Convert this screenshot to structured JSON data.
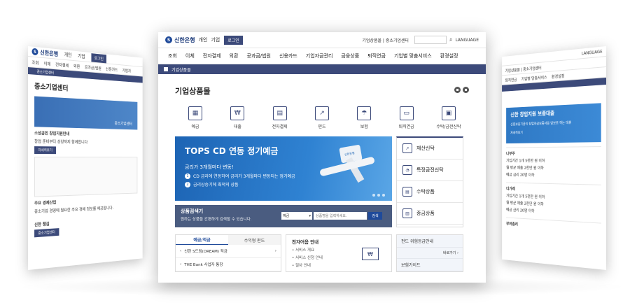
{
  "left_panel": {
    "logo": "신한은행",
    "top_links": [
      "개인",
      "기업"
    ],
    "login": "로그인",
    "nav": [
      "조회",
      "이체",
      "전자결제",
      "외환",
      "공과금/법원",
      "신용카드",
      "기업자"
    ],
    "bar": "중소기업센터",
    "title": "중소기업센터",
    "banner_caption": "중소기업센터",
    "notice_title": "소상공인 창업지원안내",
    "notice_text": "창업 준비부터 성장까지 함께합니다",
    "button": "자세히보기",
    "section": "주요 경제산업",
    "section_text": "중소기업 경영에 필요한 주요 경제 정보를 제공합니다.",
    "bottom": "신한 챙김",
    "bottom_btn": "중소기업센터"
  },
  "right_panel": {
    "lang": "LANGUAGE",
    "top_links": "기업상품몰 | 중소기업센터",
    "nav": [
      "퇴직연금",
      "기업별 맞춤서비스",
      "환경설정"
    ],
    "banner_title": "신한 창업지원 보증대출",
    "banner_text": "신용보증기금의 창업자금보증서를 담보로 하는 대출",
    "banner_link": "자세히보기",
    "sections": [
      "나부주",
      "디가레",
      "부여총리"
    ],
    "rows": [
      "가입기간 1개 5천만 원 이하",
      "월 평균 매출 2천만 원 이하",
      "예금 금리 20명 이하"
    ]
  },
  "main": {
    "logo": "신한은행",
    "top_links": [
      "개인",
      "기업"
    ],
    "login": "로그인",
    "right_links": "기업상품몰 | 중소기업센터",
    "lang": "LANGUAGE",
    "nav": [
      "조회",
      "이체",
      "전자결제",
      "외환",
      "공과금/법원",
      "신용카드",
      "기업자금관리",
      "금융상품",
      "퇴직연금",
      "기업별 맞춤서비스",
      "환경설정"
    ],
    "breadcrumb": "기업상품몰",
    "title": "기업상품몰",
    "categories": [
      {
        "label": "예금",
        "icon": "deposit-icon",
        "glyph": "▦"
      },
      {
        "label": "대출",
        "icon": "loan-icon",
        "glyph": "₩"
      },
      {
        "label": "전자결제",
        "icon": "epayment-icon",
        "glyph": "▤"
      },
      {
        "label": "펀드",
        "icon": "fund-icon",
        "glyph": "↗"
      },
      {
        "label": "보험",
        "icon": "insurance-icon",
        "glyph": "☂"
      },
      {
        "label": "퇴직연금",
        "icon": "pension-icon",
        "glyph": "▭"
      },
      {
        "label": "수탁/금전신탁",
        "icon": "trust-icon",
        "glyph": "▣"
      }
    ],
    "hero": {
      "title": "TOPS CD 연동 정기예금",
      "subtitle": "금리가 3개월마다 변동!",
      "items": [
        {
          "num": "1",
          "text": "CD 금리에 연동하여 금리가 3개월마다 변동되는 정기예금"
        },
        {
          "num": "2",
          "text": "금리상승기에 최적의 상품"
        }
      ],
      "card_label": "신한은행"
    },
    "side_menu": [
      {
        "label": "재산신탁",
        "icon": "chart-icon",
        "glyph": "↗"
      },
      {
        "label": "특정금전신탁",
        "icon": "pie-icon",
        "glyph": "◔"
      },
      {
        "label": "수탁상품",
        "icon": "document-icon",
        "glyph": "▤"
      },
      {
        "label": "중금상품",
        "icon": "note-icon",
        "glyph": "▥"
      }
    ],
    "search": {
      "title": "상품검색기",
      "desc": "원하는 상품을 간편하게 검색할 수 있습니다.",
      "select": "예금",
      "placeholder": "상품명을 입력하세요.",
      "button": "검색"
    },
    "tabs": [
      "예금/적금",
      "수익형 펀드"
    ],
    "products": [
      "신한 S드림(DREAM) 적금",
      "THE Bank 사업자 통장"
    ],
    "epay": {
      "title": "전자어음 안내",
      "items": [
        "서비스 개요",
        "서비스 신청 안내",
        "절차 안내"
      ]
    },
    "guide": {
      "title": "펀드 위험등급안내",
      "more": "바로가기",
      "title2": "보험가이드"
    }
  }
}
